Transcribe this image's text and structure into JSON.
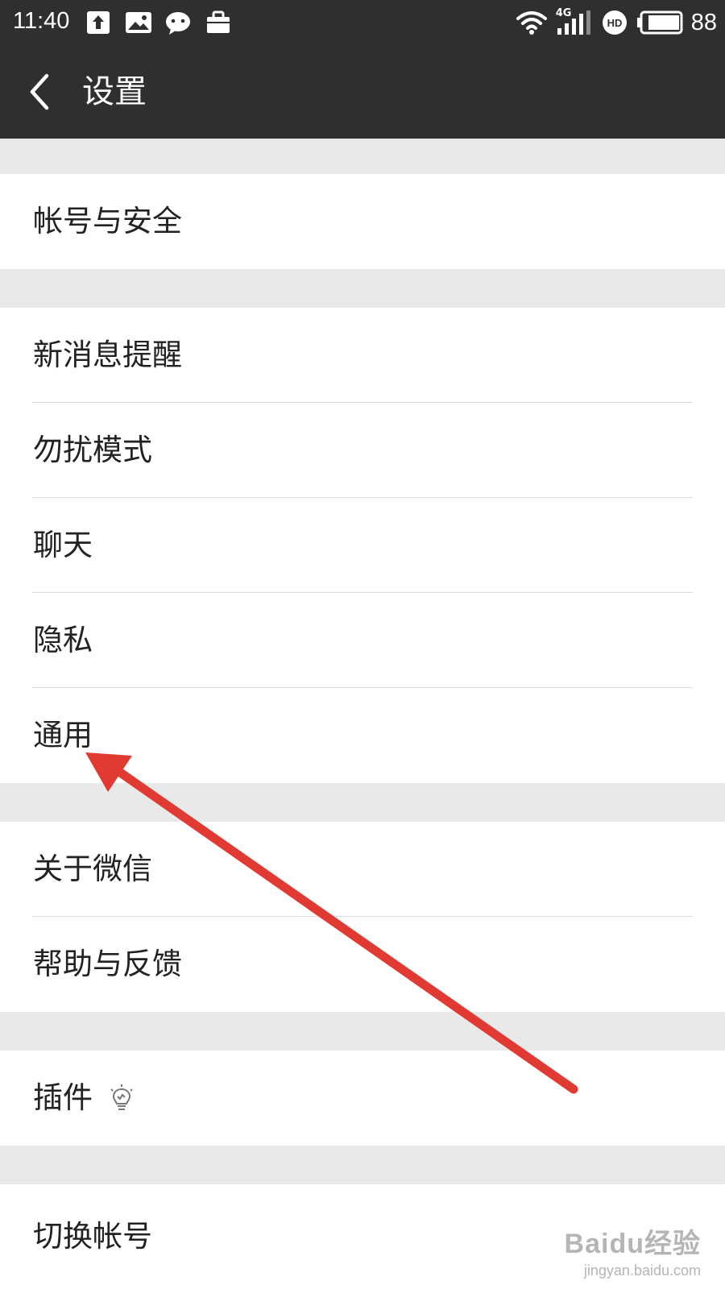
{
  "status_bar": {
    "time": "11:40",
    "network": "4G",
    "battery": "88",
    "left_icons": [
      "upload-icon",
      "photo-icon",
      "wechat-icon",
      "briefcase-icon"
    ],
    "right_icons": [
      "wifi-icon",
      "signal-icon",
      "hd-icon",
      "battery-icon"
    ]
  },
  "header": {
    "title": "设置",
    "back_icon": "chevron-left-icon"
  },
  "groups": [
    {
      "items": [
        {
          "label": "帐号与安全"
        }
      ]
    },
    {
      "items": [
        {
          "label": "新消息提醒"
        },
        {
          "label": "勿扰模式"
        },
        {
          "label": "聊天"
        },
        {
          "label": "隐私"
        },
        {
          "label": "通用"
        }
      ]
    },
    {
      "items": [
        {
          "label": "关于微信"
        },
        {
          "label": "帮助与反馈"
        }
      ]
    },
    {
      "items": [
        {
          "label": "插件",
          "icon": "lightbulb-icon"
        }
      ]
    },
    {
      "items": [
        {
          "label": "切换帐号"
        }
      ]
    }
  ],
  "annotation": {
    "arrow_color": "#e03a32",
    "arrow_target": "通用"
  },
  "watermark": {
    "main": "Baidu经验",
    "sub": "jingyan.baidu.com"
  },
  "colors": {
    "bar": "#2f2f2f",
    "background": "#e9e9e9",
    "cell": "#ffffff",
    "divider": "#dcdcdc"
  }
}
